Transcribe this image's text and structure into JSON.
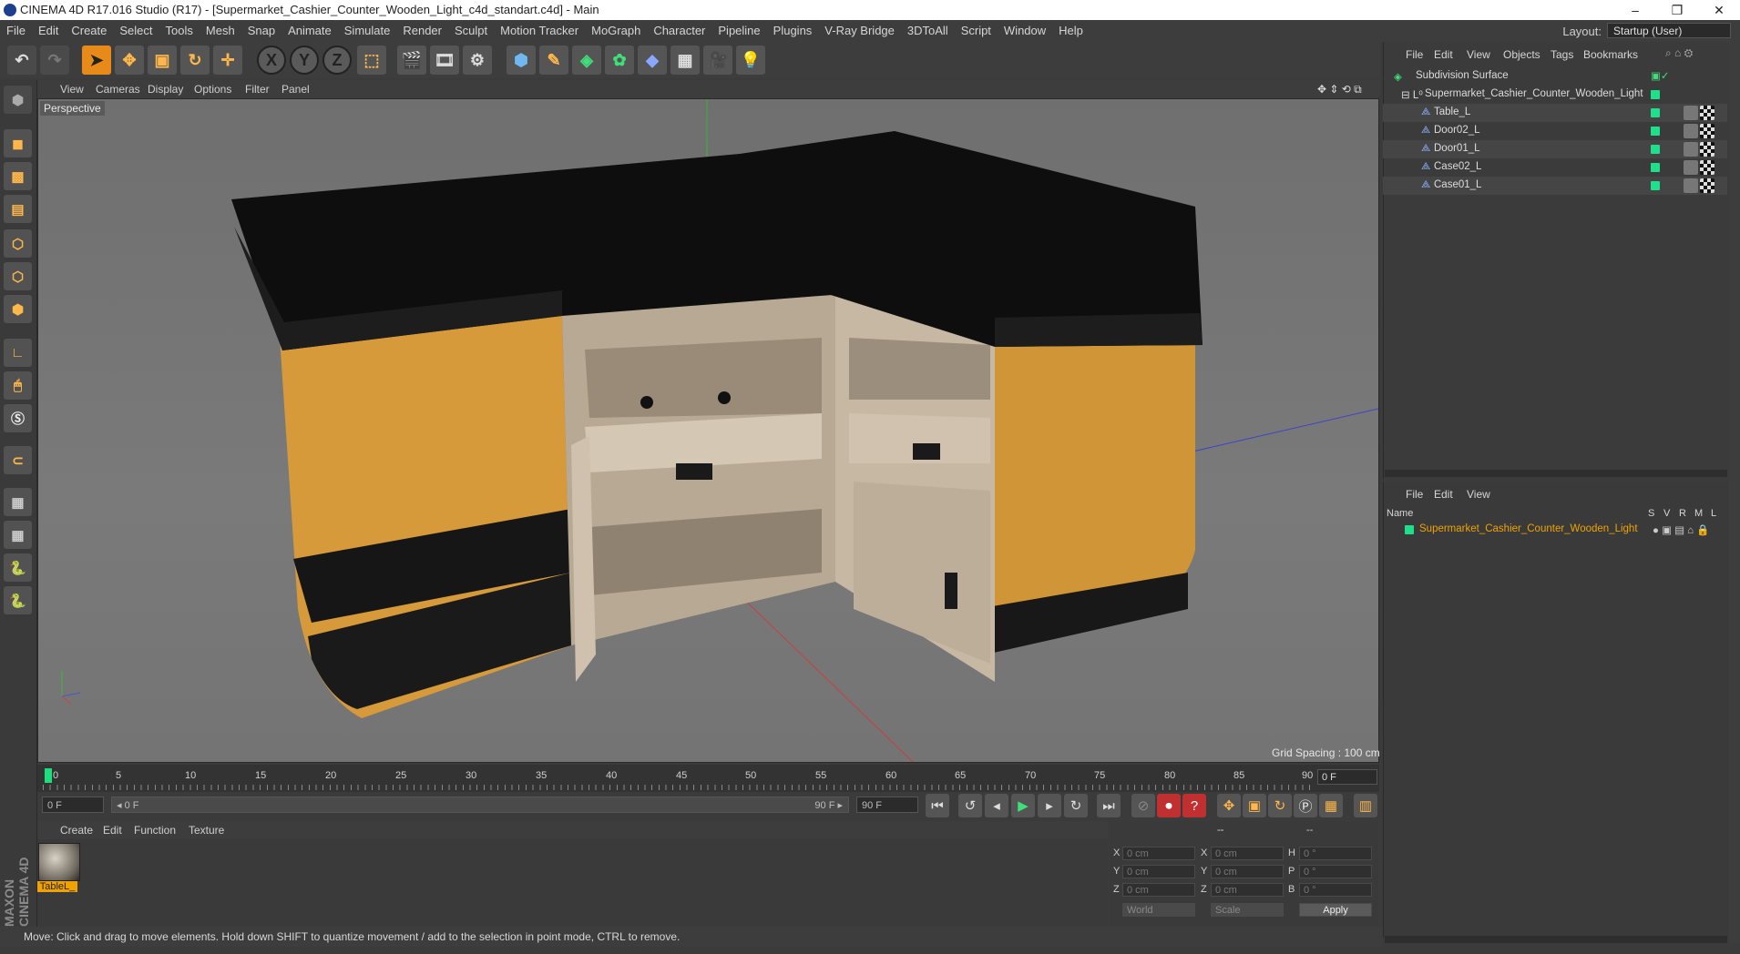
{
  "titlebar": {
    "title": "CINEMA 4D R17.016 Studio (R17) - [Supermarket_Cashier_Counter_Wooden_Light_c4d_standart.c4d] - Main",
    "min": "–",
    "restore": "❐",
    "close": "✕"
  },
  "menu": [
    "File",
    "Edit",
    "Create",
    "Select",
    "Tools",
    "Mesh",
    "Snap",
    "Animate",
    "Simulate",
    "Render",
    "Sculpt",
    "Motion Tracker",
    "MoGraph",
    "Character",
    "Pipeline",
    "Plugins",
    "V-Ray Bridge",
    "3DToAll",
    "Script",
    "Window",
    "Help"
  ],
  "layout": {
    "label": "Layout:",
    "value": "Startup (User)"
  },
  "viewport": {
    "menu": [
      "View",
      "Cameras",
      "Display",
      "Options",
      "Filter",
      "Panel"
    ],
    "camera": "Perspective",
    "grid_spacing": "Grid Spacing : 100 cm"
  },
  "timeline": {
    "ticks": [
      "0",
      "5",
      "10",
      "15",
      "20",
      "25",
      "30",
      "35",
      "40",
      "45",
      "50",
      "55",
      "60",
      "65",
      "70",
      "75",
      "80",
      "85",
      "90"
    ],
    "current_frame": "0 F",
    "start_field": "0 F",
    "range_start": "◂ 0 F",
    "range_end": "90 F ▸",
    "end_field": "90 F"
  },
  "material_manager": {
    "menu": [
      "Create",
      "Edit",
      "Function",
      "Texture"
    ],
    "material_name": "TableL_"
  },
  "coordinates": {
    "header": [
      "--",
      "--",
      "--"
    ],
    "rows": [
      {
        "a": "X",
        "av": "0 cm",
        "b": "X",
        "bv": "0 cm",
        "c": "H",
        "cv": "0 °"
      },
      {
        "a": "Y",
        "av": "0 cm",
        "b": "Y",
        "bv": "0 cm",
        "c": "P",
        "cv": "0 °"
      },
      {
        "a": "Z",
        "av": "0 cm",
        "b": "Z",
        "bv": "0 cm",
        "c": "B",
        "cv": "0 °"
      }
    ],
    "space": "World",
    "mode": "Scale",
    "apply": "Apply"
  },
  "status": "Move: Click and drag to move elements. Hold down SHIFT to quantize movement / add to the selection in point mode, CTRL to remove.",
  "maxon": "MAXON CINEMA 4D",
  "object_manager": {
    "menu": [
      "File",
      "Edit",
      "View",
      "Objects",
      "Tags",
      "Bookmarks"
    ],
    "objects": [
      {
        "name": "Subdivision Surface"
      },
      {
        "name": "Supermarket_Cashier_Counter_Wooden_Light"
      },
      {
        "name": "Table_L"
      },
      {
        "name": "Door02_L"
      },
      {
        "name": "Door01_L"
      },
      {
        "name": "Case02_L"
      },
      {
        "name": "Case01_L"
      }
    ]
  },
  "attribute_manager": {
    "menu": [
      "File",
      "Edit",
      "View"
    ],
    "columns": {
      "name": "Name",
      "s": "S",
      "v": "V",
      "r": "R",
      "m": "M",
      "l": "L"
    },
    "selected": "Supermarket_Cashier_Counter_Wooden_Light"
  },
  "colors": {
    "accent": "#f0a300",
    "green": "#1ee08a",
    "axis_y": "#2dbb2d",
    "axis_x": "#d03a3a",
    "axis_z": "#3a46c8"
  }
}
